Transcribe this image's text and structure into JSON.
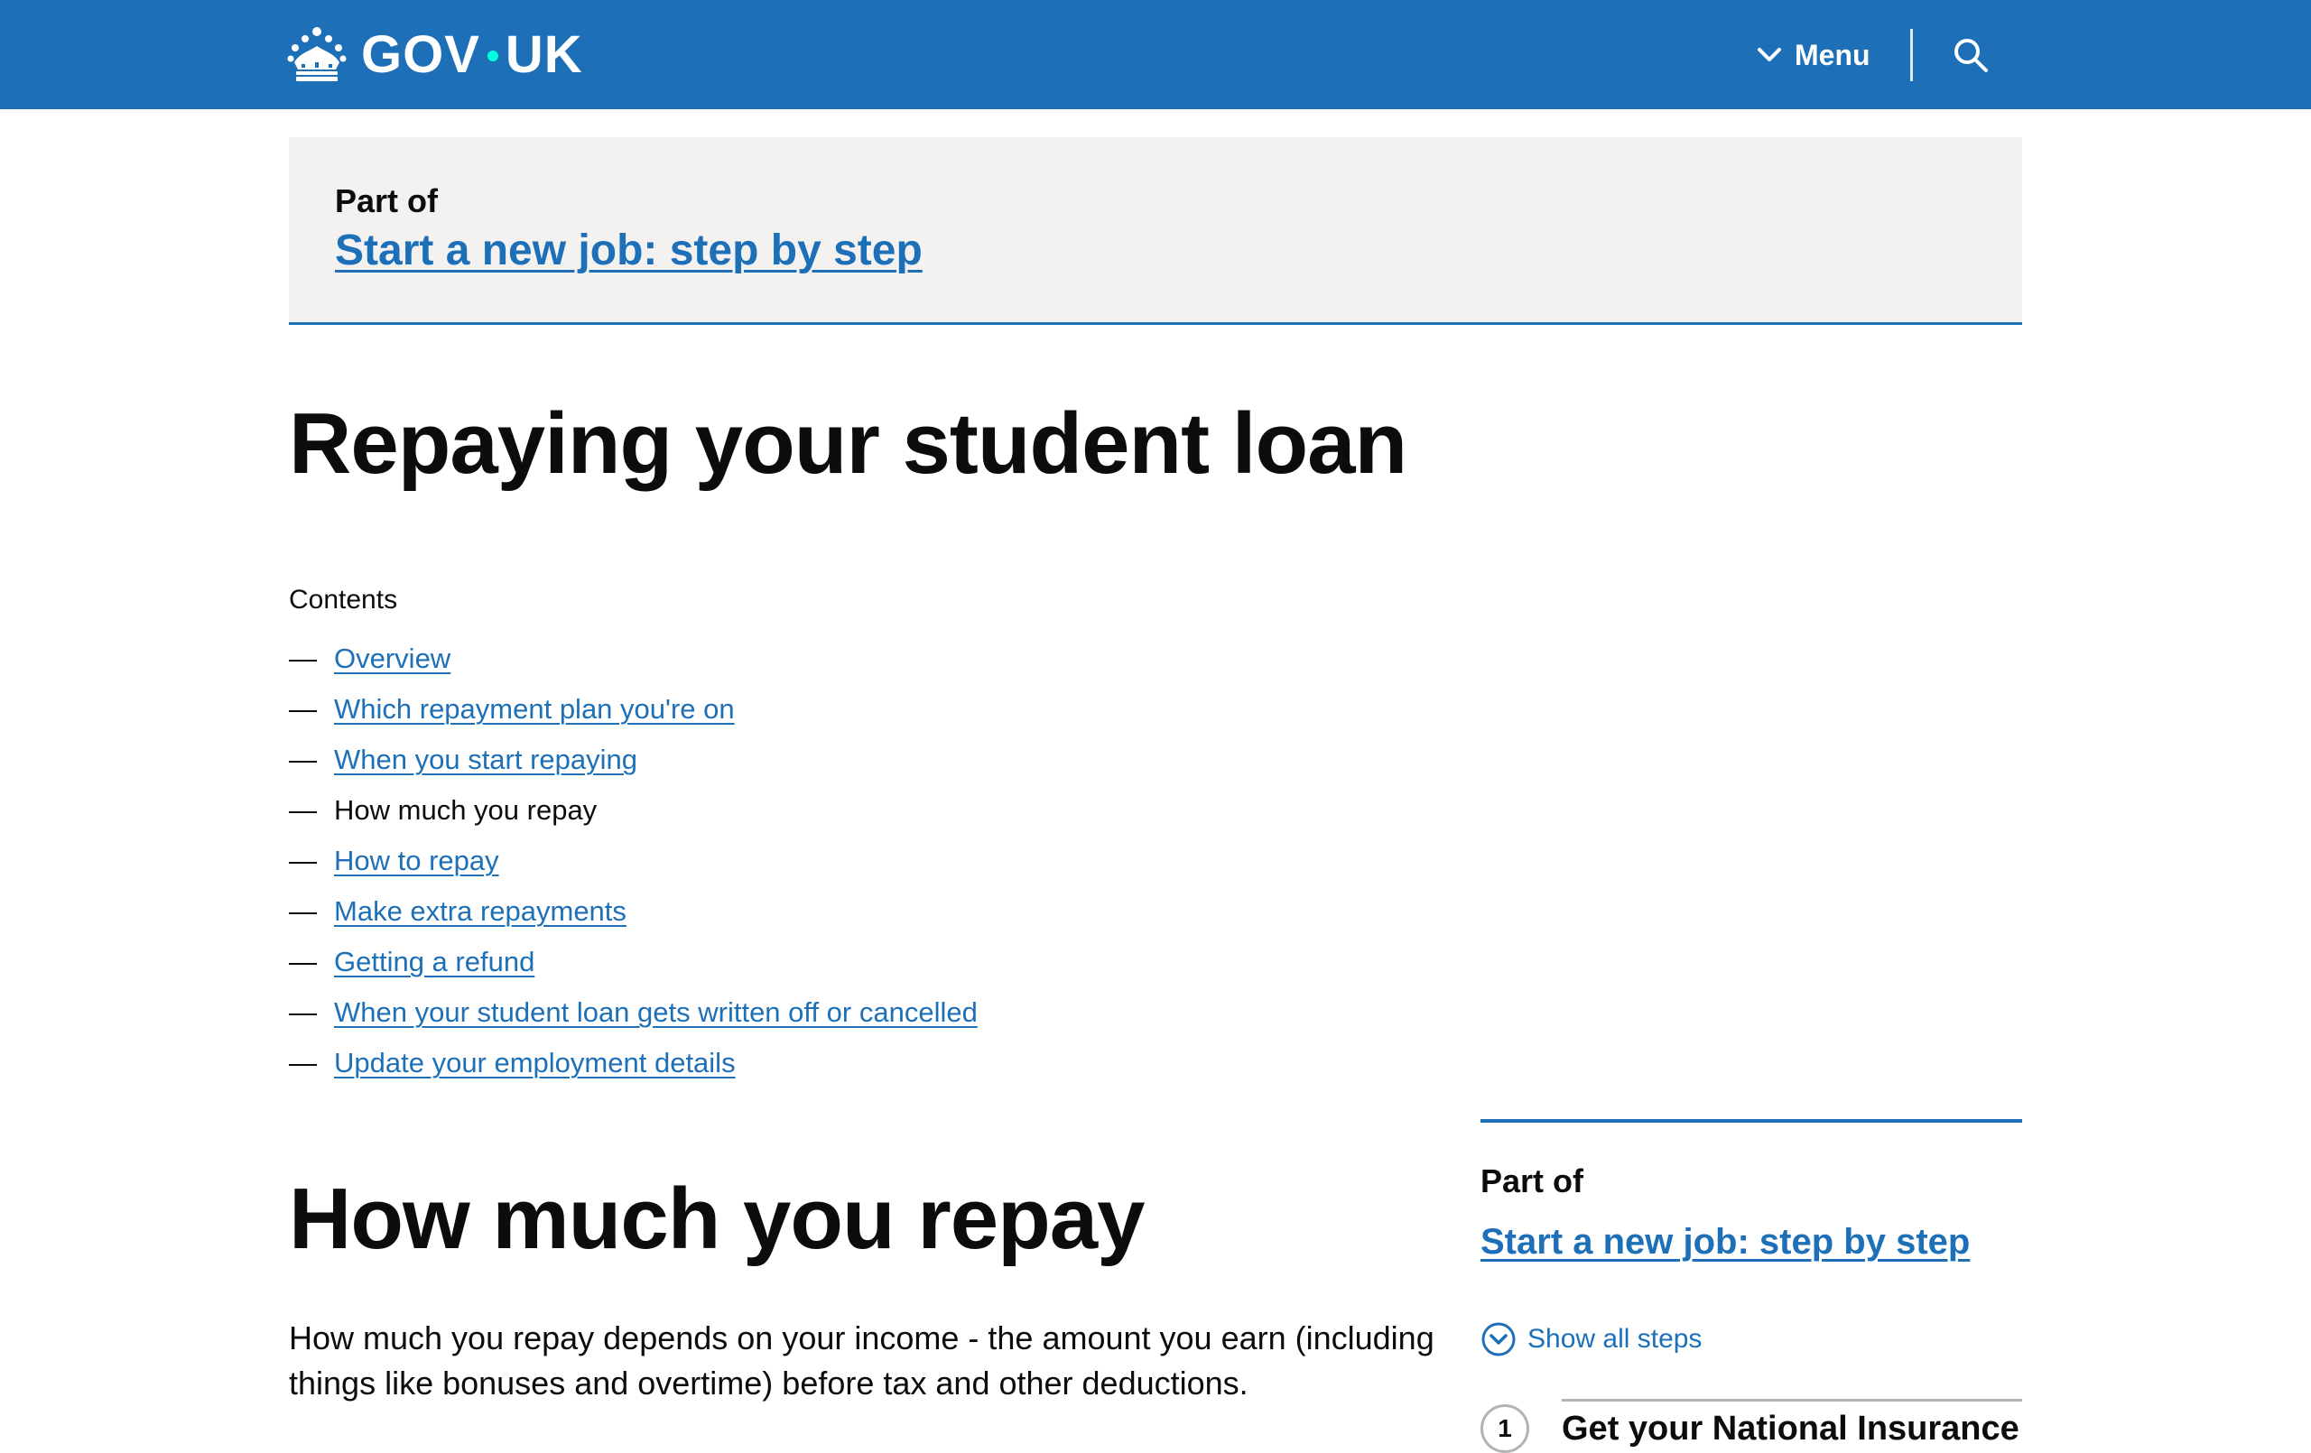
{
  "header": {
    "logo_text": "GOV.UK",
    "logo_left": "GOV",
    "logo_right": "UK",
    "menu_label": "Menu",
    "colors": {
      "header_bg": "#1d70b8",
      "logo_dot": "#00ffe0"
    }
  },
  "banner": {
    "part_of_label": "Part of",
    "link_text": "Start a new job: step by step"
  },
  "page": {
    "title": "Repaying your student loan"
  },
  "contents": {
    "heading": "Contents",
    "items": [
      {
        "label": "Overview",
        "current": false
      },
      {
        "label": "Which repayment plan you're on",
        "current": false
      },
      {
        "label": "When you start repaying",
        "current": false
      },
      {
        "label": "How much you repay",
        "current": true
      },
      {
        "label": "How to repay",
        "current": false
      },
      {
        "label": "Make extra repayments",
        "current": false
      },
      {
        "label": "Getting a refund",
        "current": false
      },
      {
        "label": "When your student loan gets written off or cancelled",
        "current": false
      },
      {
        "label": "Update your employment details",
        "current": false
      }
    ]
  },
  "section": {
    "title": "How much you repay",
    "paragraph": "How much you repay depends on your income - the amount you earn (including things like bonuses and overtime) before tax and other deductions."
  },
  "sidebar": {
    "part_of_label": "Part of",
    "link_text": "Start a new job: step by step",
    "show_all_label": "Show all steps",
    "first_step_number": "1",
    "first_step_title": "Get your National Insurance"
  },
  "icons": [
    "crown-icon",
    "chevron-down-icon",
    "search-icon",
    "chevron-circle-icon"
  ]
}
